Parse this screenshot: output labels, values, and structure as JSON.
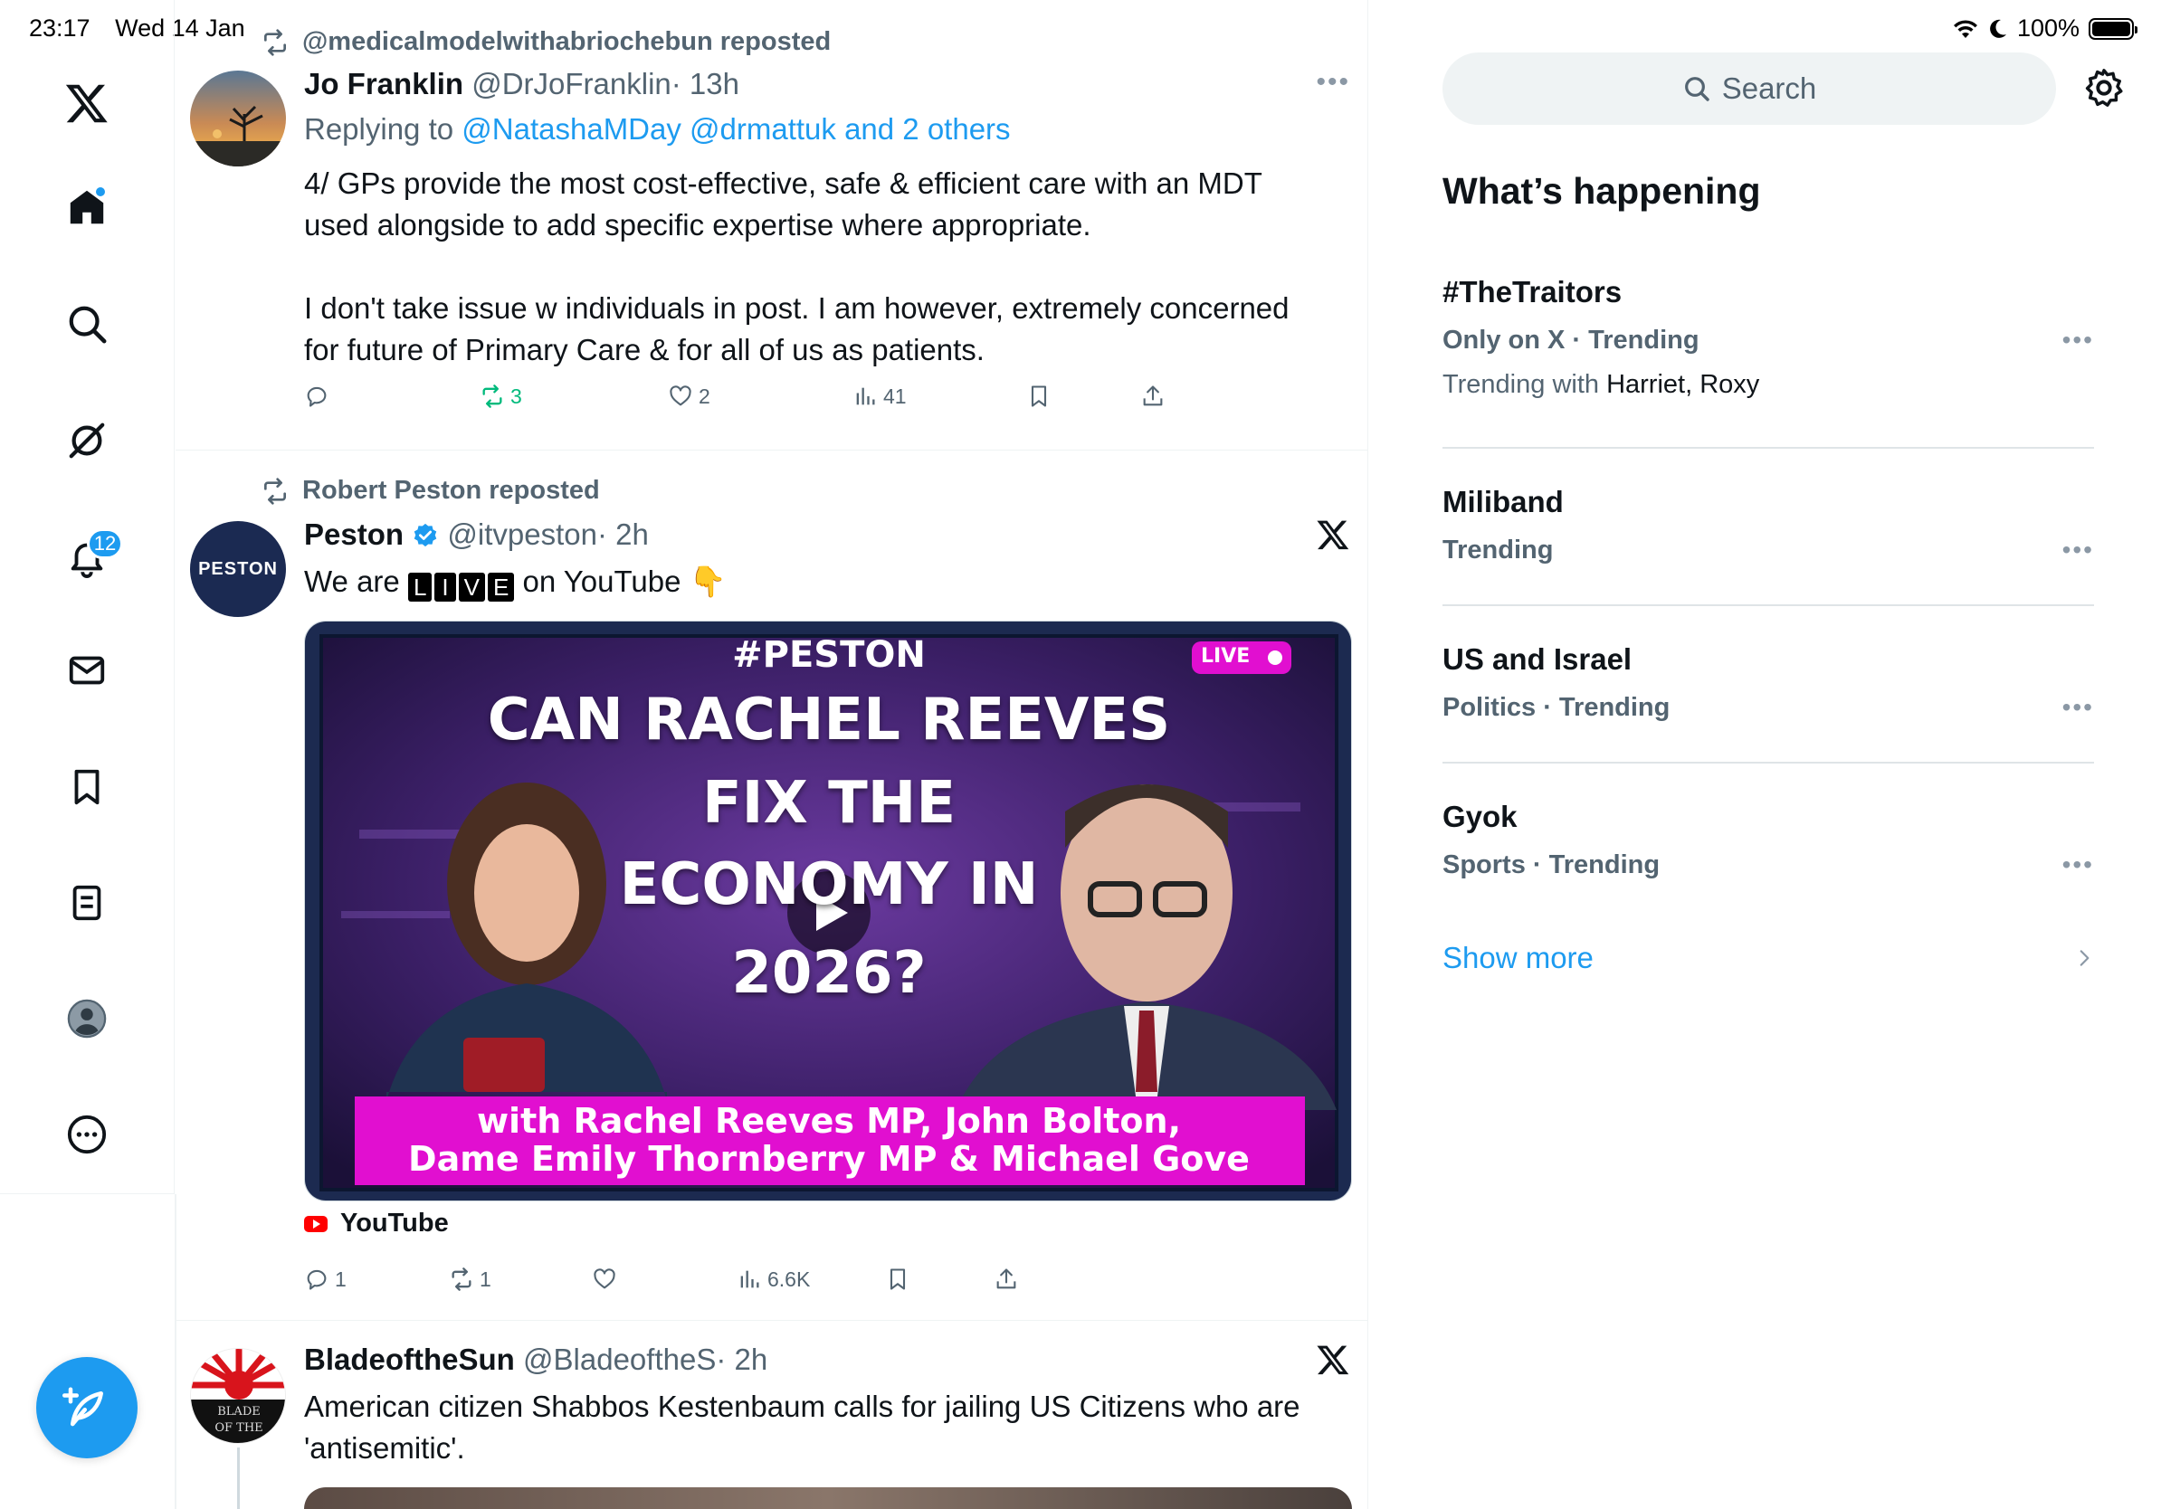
{
  "status": {
    "time": "23:17",
    "date": "Wed 14 Jan",
    "battery": "100%",
    "battery_level": 1.0
  },
  "nav": {
    "items": [
      "X logo",
      "Home",
      "Explore",
      "Grok",
      "Notifications",
      "Messages",
      "Bookmarks",
      "Lists",
      "Profile",
      "More"
    ],
    "notifications_badge": "12"
  },
  "feed": {
    "tweets": [
      {
        "repost_by": "@medicalmodelwithabriochebun reposted",
        "name": "Jo Franklin",
        "handle": "@DrJoFranklin",
        "time": "· 13h",
        "reply_prefix": "Replying to",
        "reply_to": "@NatashaMDay @drmattuk and 2 others",
        "text_1": "4/ GPs provide the most cost-effective, safe & efficient care with an MDT used alongside to add specific expertise where appropriate.",
        "text_2": "I don't take issue w individuals in post. I am however, extremely concerned for future of Primary Care & for all of us as patients.",
        "replies": "",
        "reposts": "3",
        "likes": "2",
        "views": "41"
      },
      {
        "repost_by": "Robert Peston reposted",
        "name": "Peston",
        "handle": "@itvpeston",
        "time": "· 2h",
        "avatar_text": "PESTON",
        "text_before": "We are",
        "live_letters": [
          "L",
          "I",
          "V",
          "E"
        ],
        "text_after": "on YouTube 👇",
        "media": {
          "hashtag": "#PESTON",
          "live_badge": "LIVE",
          "headline_1": "CAN RACHEL REEVES",
          "headline_2": "FIX THE",
          "headline_3": "ECONOMY IN",
          "headline_4": "2026?",
          "banner_1": "with Rachel Reeves MP, John Bolton,",
          "banner_2": "Dame Emily Thornberry MP & Michael Gove"
        },
        "source": "YouTube",
        "replies": "1",
        "reposts": "1",
        "likes": "",
        "views": "6.6K"
      },
      {
        "name": "BladeoftheSun",
        "handle": "@BladeoftheS",
        "time": "· 2h",
        "avatar_text_1": "BLADE",
        "avatar_text_2": "OF THE",
        "text": "American citizen Shabbos Kestenbaum calls for jailing US Citizens who are 'antisemitic'."
      }
    ]
  },
  "sidebar": {
    "search_placeholder": "Search",
    "section_title": "What’s happening",
    "trends": [
      {
        "title": "#TheTraitors",
        "meta": "Only on X · Trending",
        "with_prefix": "Trending with",
        "with_names": "Harriet, Roxy"
      },
      {
        "title": "Miliband",
        "meta": "Trending"
      },
      {
        "title": "US and Israel",
        "meta": "Politics · Trending"
      },
      {
        "title": "Gyok",
        "meta": "Sports · Trending"
      }
    ],
    "show_more": "Show more"
  },
  "colors": {
    "accent": "#1d9bf0",
    "repost_green": "#00ba7c",
    "muted": "#536471"
  }
}
